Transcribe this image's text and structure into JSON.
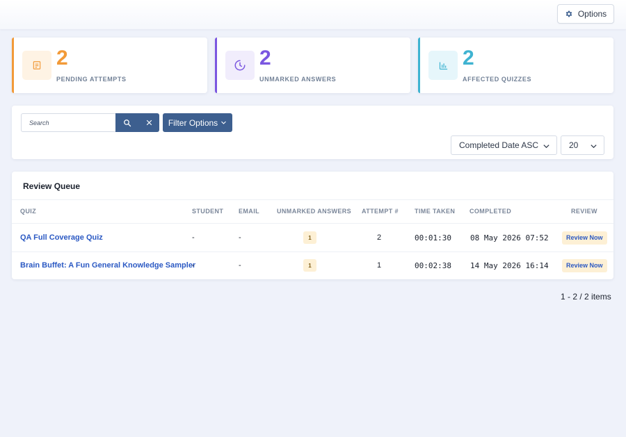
{
  "header": {
    "options_label": "Options",
    "options_icon": "gear-icon"
  },
  "stats": [
    {
      "value": "2",
      "label": "PENDING ATTEMPTS",
      "icon": "document-icon",
      "color": "#f29a38"
    },
    {
      "value": "2",
      "label": "UNMARKED ANSWERS",
      "icon": "clock-icon",
      "color": "#7b57e0"
    },
    {
      "value": "2",
      "label": "AFFECTED QUIZZES",
      "icon": "bar-chart-icon",
      "color": "#3fb3d1"
    }
  ],
  "filters": {
    "search_placeholder": "Search",
    "search_value": "",
    "filter_label": "Filter Options",
    "sort_value": "Completed Date ASC",
    "page_size": "20"
  },
  "queue": {
    "title": "Review Queue",
    "columns": [
      "QUIZ",
      "STUDENT",
      "EMAIL",
      "UNMARKED ANSWERS",
      "ATTEMPT #",
      "TIME TAKEN",
      "COMPLETED",
      "REVIEW"
    ],
    "rows": [
      {
        "quiz": "QA Full Coverage Quiz",
        "student": "-",
        "email": "-",
        "unmarked": "1",
        "attempt": "2",
        "time_taken": "00:01:30",
        "completed": "08 May 2026 07:52",
        "review": "Review Now"
      },
      {
        "quiz": "Brain Buffet: A Fun General Knowledge Sampler",
        "student": "-",
        "email": "-",
        "unmarked": "1",
        "attempt": "1",
        "time_taken": "00:02:38",
        "completed": "14 May 2026 16:14",
        "review": "Review Now"
      }
    ]
  },
  "pagination": {
    "summary": "1 - 2 / 2 items"
  },
  "colors": {
    "primary": "#3d5f8f",
    "link": "#2b59c3",
    "badge_bg": "#fdf0d5"
  }
}
